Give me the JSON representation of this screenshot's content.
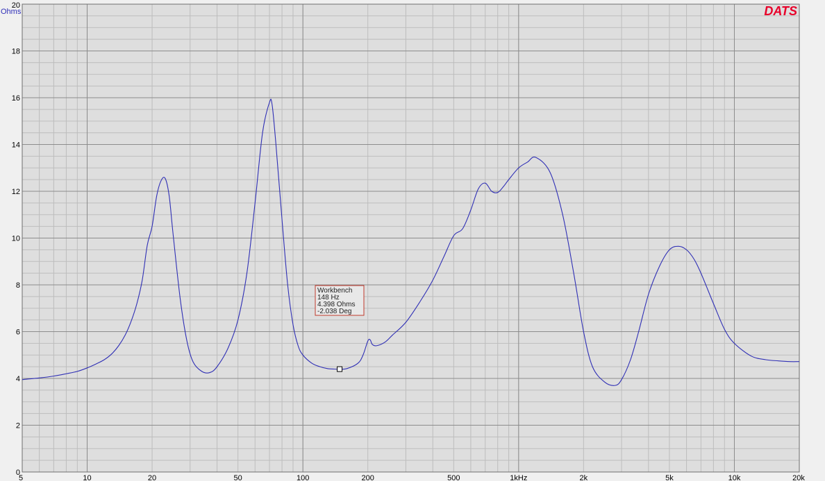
{
  "app": {
    "brand": "DATS"
  },
  "colors": {
    "plot_bg": "#dedede",
    "grid_major": "#8c8c8c",
    "grid_minor": "#bdbdbd",
    "trace": "#2f2fb5",
    "brand": "#e8002a",
    "tooltip_border": "#c0392b",
    "tooltip_bg": "#e8e8e8"
  },
  "chart_data": {
    "type": "line",
    "title": "",
    "xlabel": "",
    "ylabel": "Ohms",
    "xscale": "log",
    "xlim": [
      5,
      20000
    ],
    "ylim": [
      0,
      20
    ],
    "grid": true,
    "x_ticks": [
      {
        "value": 5,
        "label": "5"
      },
      {
        "value": 10,
        "label": "10"
      },
      {
        "value": 20,
        "label": "20"
      },
      {
        "value": 50,
        "label": "50"
      },
      {
        "value": 100,
        "label": "100"
      },
      {
        "value": 200,
        "label": "200"
      },
      {
        "value": 500,
        "label": "500"
      },
      {
        "value": 1000,
        "label": "1kHz"
      },
      {
        "value": 2000,
        "label": "2k"
      },
      {
        "value": 5000,
        "label": "5k"
      },
      {
        "value": 10000,
        "label": "10k"
      },
      {
        "value": 20000,
        "label": "20k"
      }
    ],
    "y_ticks": [
      0,
      2,
      4,
      6,
      8,
      10,
      12,
      14,
      16,
      18,
      20
    ],
    "series": [
      {
        "name": "Workbench",
        "x": [
          5,
          6,
          7,
          8,
          9,
          10,
          11,
          12,
          13,
          14,
          15,
          16,
          17,
          18,
          19,
          20,
          21,
          22,
          23,
          24,
          25,
          27,
          29,
          31,
          34,
          37,
          40,
          45,
          50,
          55,
          60,
          65,
          70,
          72,
          75,
          80,
          85,
          90,
          95,
          100,
          110,
          120,
          130,
          140,
          148,
          160,
          180,
          190,
          200,
          205,
          210,
          220,
          240,
          260,
          300,
          350,
          400,
          450,
          500,
          550,
          600,
          650,
          700,
          750,
          800,
          850,
          900,
          1000,
          1100,
          1200,
          1400,
          1600,
          1800,
          2000,
          2200,
          2500,
          2800,
          3000,
          3300,
          3600,
          4000,
          4500,
          5000,
          5500,
          6000,
          6500,
          7000,
          8000,
          9000,
          10000,
          12000,
          14000,
          16000,
          18000,
          20000
        ],
        "y": [
          3.95,
          4.02,
          4.1,
          4.2,
          4.3,
          4.45,
          4.62,
          4.8,
          5.05,
          5.4,
          5.85,
          6.45,
          7.2,
          8.2,
          9.7,
          10.5,
          11.8,
          12.45,
          12.55,
          11.8,
          10.2,
          7.4,
          5.6,
          4.7,
          4.3,
          4.25,
          4.5,
          5.3,
          6.5,
          8.5,
          11.5,
          14.5,
          15.8,
          15.7,
          14.0,
          10.8,
          8.0,
          6.3,
          5.4,
          5.0,
          4.65,
          4.5,
          4.42,
          4.4,
          4.398,
          4.42,
          4.65,
          5.0,
          5.6,
          5.65,
          5.45,
          5.4,
          5.55,
          5.85,
          6.4,
          7.3,
          8.2,
          9.2,
          10.1,
          10.4,
          11.2,
          12.1,
          12.35,
          12.0,
          11.95,
          12.2,
          12.5,
          13.0,
          13.25,
          13.45,
          12.8,
          11.0,
          8.5,
          6.0,
          4.5,
          3.85,
          3.7,
          3.95,
          4.8,
          6.0,
          7.6,
          8.8,
          9.5,
          9.65,
          9.5,
          9.1,
          8.5,
          7.2,
          6.1,
          5.5,
          4.95,
          4.8,
          4.75,
          4.72,
          4.72
        ]
      }
    ],
    "marker": {
      "series": "Workbench",
      "freq": 148,
      "lines": [
        "Workbench",
        "148 Hz",
        "4.398 Ohms",
        "-2.038 Deg"
      ]
    }
  }
}
